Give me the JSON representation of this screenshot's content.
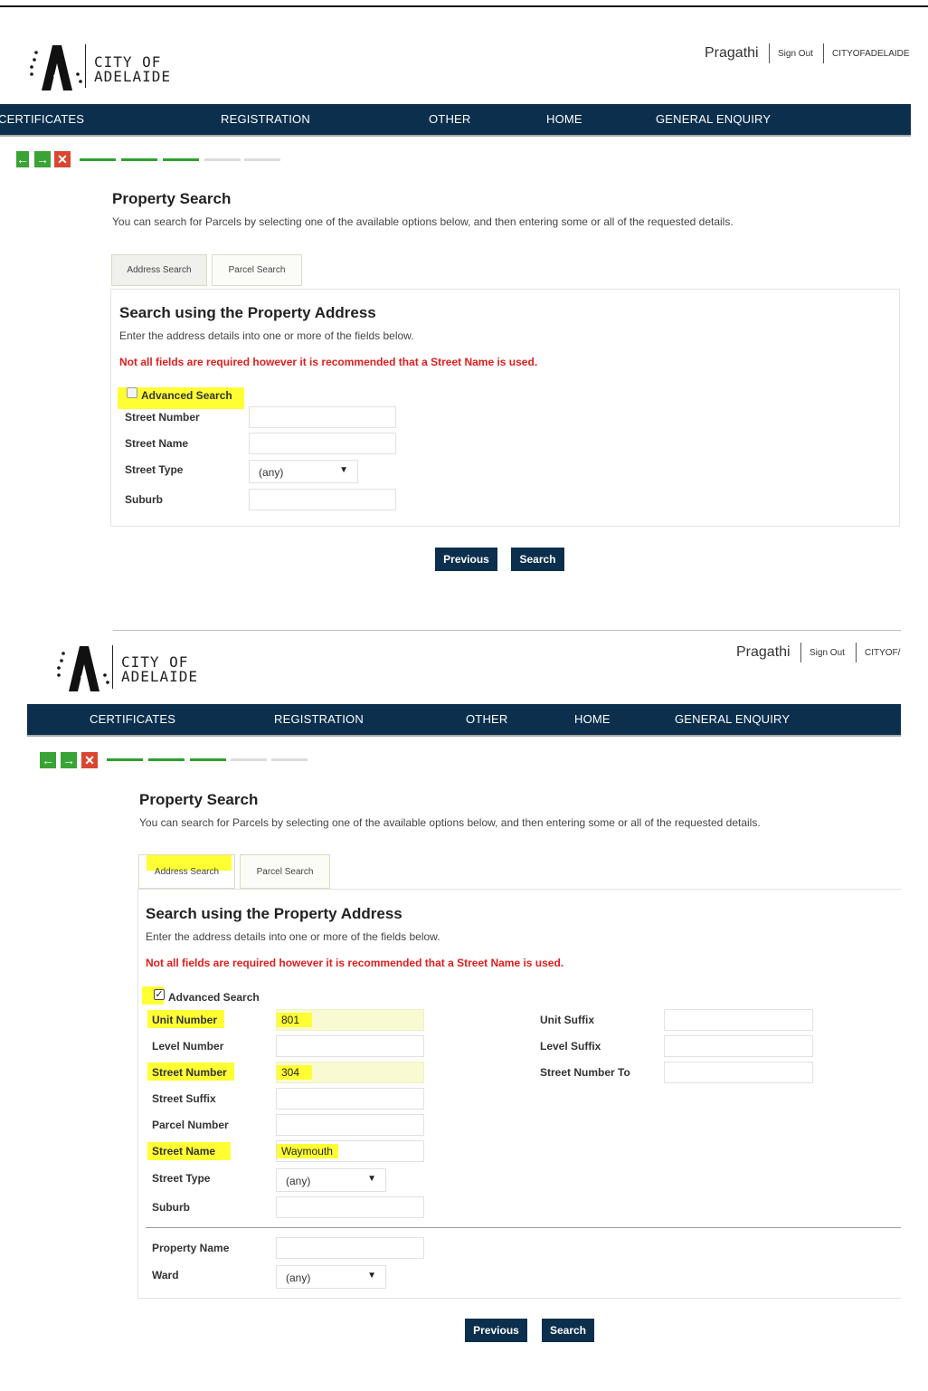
{
  "logo": {
    "line1": "CITY OF",
    "line2": "ADELAIDE"
  },
  "user": {
    "name": "Pragathi",
    "sign_out": "Sign Out",
    "account_1": "CITYOFADELAIDE",
    "account_2": "CITYOF/"
  },
  "nav": {
    "items": [
      "CERTIFICATES",
      "REGISTRATION",
      "OTHER",
      "HOME",
      "GENERAL ENQUIRY"
    ],
    "items_1": [
      "CERTIFICATES",
      "REGISTRATION",
      "OTHER",
      "HOME",
      "GENERAL ENQUIRY"
    ]
  },
  "wizard": {
    "back_icon": "left-arrow-icon",
    "next_icon": "right-arrow-icon",
    "cancel_icon": "close-icon",
    "steps_done": 3,
    "steps_total": 5
  },
  "page": {
    "title": "Property Search",
    "description": "You can search for Parcels by selecting one of the available options below, and then entering some or all of the requested details."
  },
  "tabs": {
    "address": "Address Search",
    "parcel": "Parcel Search"
  },
  "search": {
    "title": "Search using the Property Address",
    "description": "Enter the address details into one or more of the fields below.",
    "warning": "Not all fields are required however it is recommended that a Street Name is used.",
    "advanced_label": "Advanced Search"
  },
  "labels": {
    "unit_number": "Unit Number",
    "level_number": "Level Number",
    "street_number": "Street Number",
    "street_suffix": "Street Suffix",
    "parcel_number": "Parcel Number",
    "street_name": "Street Name",
    "street_type": "Street Type",
    "suburb": "Suburb",
    "unit_suffix": "Unit Suffix",
    "level_suffix": "Level Suffix",
    "street_number_to": "Street Number To",
    "property_name": "Property Name",
    "ward": "Ward"
  },
  "values": {
    "unit_number": "801",
    "street_number": "304",
    "street_name": "Waymouth",
    "street_type": "(any)",
    "ward": "(any)"
  },
  "buttons": {
    "previous": "Previous",
    "search": "Search"
  },
  "colors": {
    "nav_bg": "#0c2f4e",
    "progress_green": "#2fa02f",
    "warning_red": "#e01e1e",
    "highlight": "#ffff33"
  }
}
